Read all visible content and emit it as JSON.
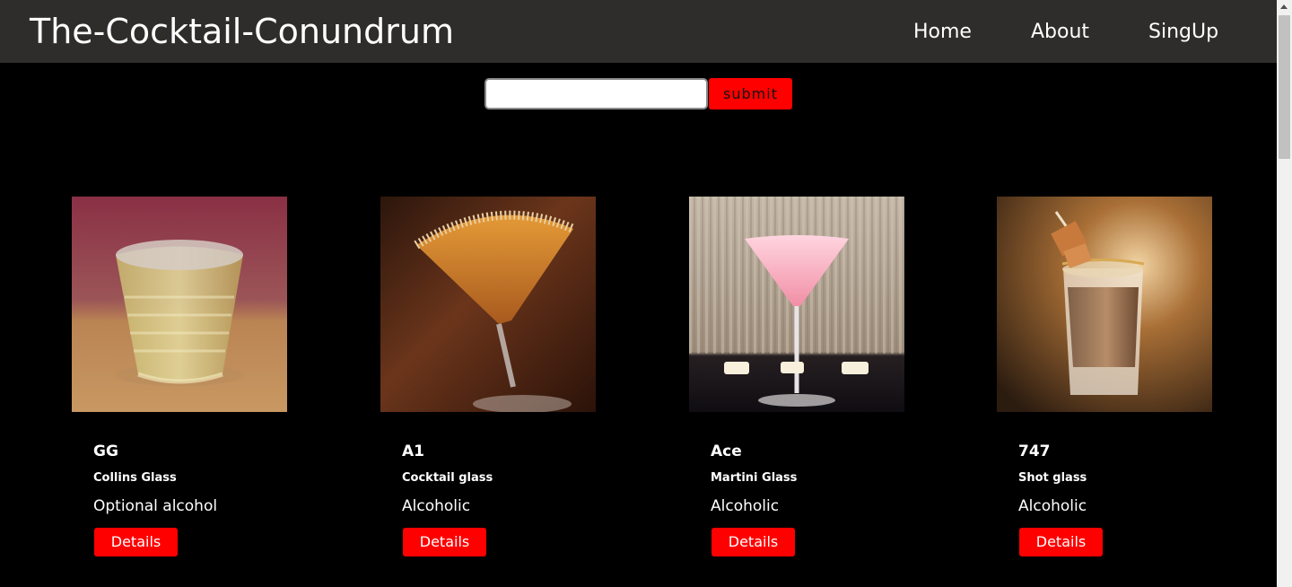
{
  "header": {
    "brand": "The-Cocktail-Conundrum",
    "nav": [
      "Home",
      "About",
      "SingUp"
    ]
  },
  "search": {
    "value": "",
    "submit_label": "submit"
  },
  "cards": [
    {
      "name": "GG",
      "glass": "Collins Glass",
      "alcohol": "Optional alcohol",
      "button": "Details"
    },
    {
      "name": "A1",
      "glass": "Cocktail glass",
      "alcohol": "Alcoholic",
      "button": "Details"
    },
    {
      "name": "Ace",
      "glass": "Martini Glass",
      "alcohol": "Alcoholic",
      "button": "Details"
    },
    {
      "name": "747",
      "glass": "Shot glass",
      "alcohol": "Alcoholic",
      "button": "Details"
    }
  ],
  "colors": {
    "navbar": "#2f2d2c",
    "page_background": "#000000",
    "accent": "#ff0000"
  }
}
